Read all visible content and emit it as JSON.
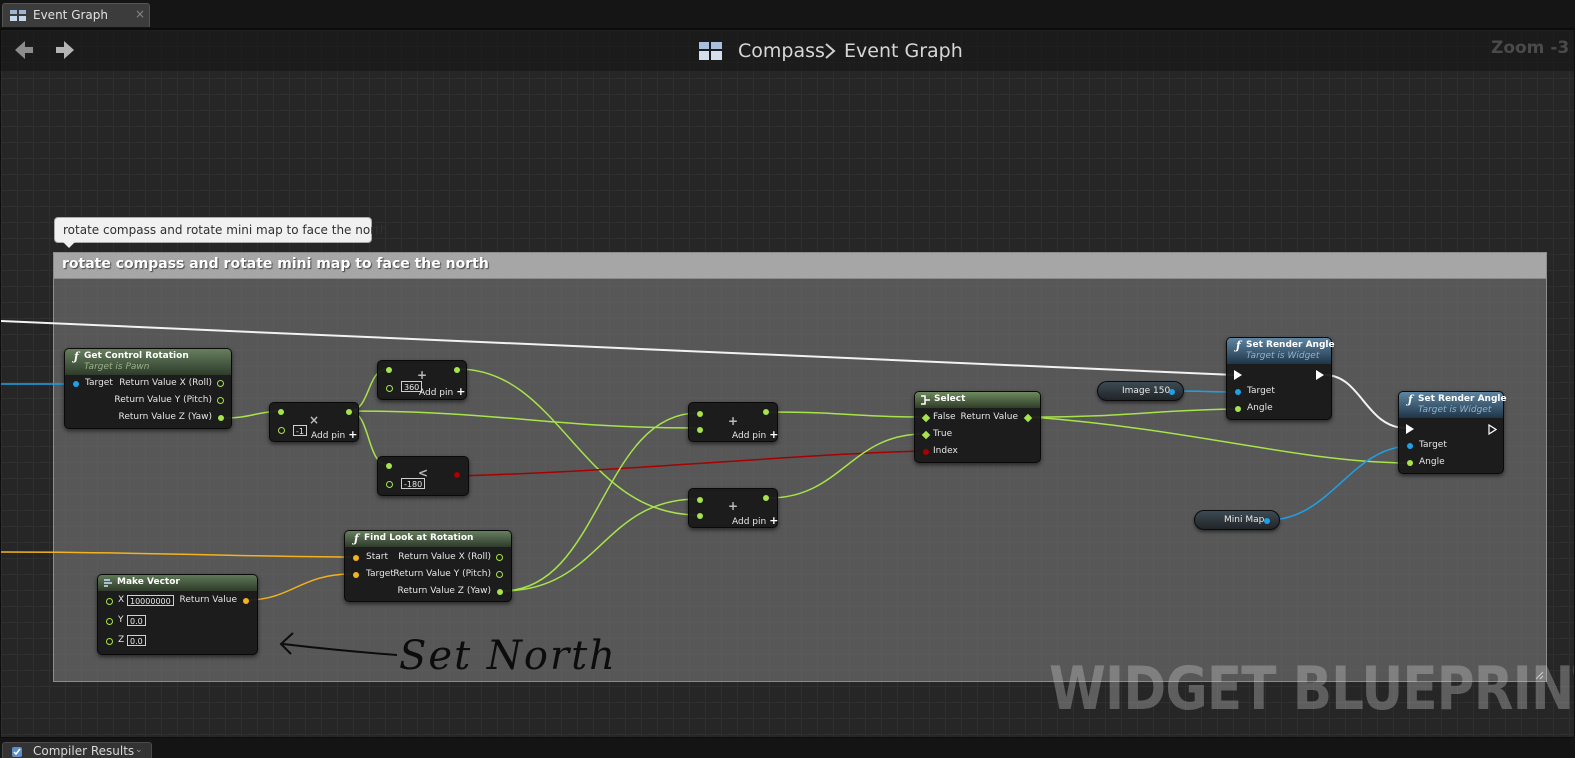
{
  "tab": {
    "label": "Event Graph",
    "close": "×"
  },
  "breadcrumb": {
    "blueprint": "Compass",
    "graph": "Event Graph"
  },
  "zoom": "Zoom -3",
  "comment": {
    "bubble": "rotate compass and rotate mini map to face the north",
    "title": "rotate compass and rotate mini map to face the north"
  },
  "nodes": {
    "get_control_rotation": {
      "title": "Get Control Rotation",
      "subtitle": "Target is Pawn",
      "in_target": "Target",
      "out_roll": "Return Value X (Roll)",
      "out_pitch": "Return Value Y (Pitch)",
      "out_yaw": "Return Value Z (Yaw)"
    },
    "multiply": {
      "operator": "×",
      "value": "-1",
      "add_pin": "Add pin"
    },
    "add_360": {
      "operator": "+",
      "value": "360",
      "add_pin": "Add pin"
    },
    "less_than": {
      "operator": "<",
      "value": "-180"
    },
    "add_a": {
      "operator": "+",
      "add_pin": "Add pin"
    },
    "add_b": {
      "operator": "+",
      "add_pin": "Add pin"
    },
    "select": {
      "title": "Select",
      "in_false": "False",
      "in_true": "True",
      "in_index": "Index",
      "out_value": "Return Value"
    },
    "image_var": {
      "name": "Image 150"
    },
    "minimap_var": {
      "name": "Mini Map"
    },
    "set_render_angle_1": {
      "title": "Set Render Angle",
      "subtitle": "Target is Widget",
      "in_target": "Target",
      "in_angle": "Angle"
    },
    "set_render_angle_2": {
      "title": "Set Render Angle",
      "subtitle": "Target is Widget",
      "in_target": "Target",
      "in_angle": "Angle"
    },
    "find_look_at": {
      "title": "Find Look at Rotation",
      "in_start": "Start",
      "in_target": "Target",
      "out_roll": "Return Value X (Roll)",
      "out_pitch": "Return Value Y (Pitch)",
      "out_yaw": "Return Value Z (Yaw)"
    },
    "make_vector": {
      "title": "Make Vector",
      "x_label": "X",
      "x_value": "10000000",
      "y_label": "Y",
      "y_value": "0.0",
      "z_label": "Z",
      "z_value": "0.0",
      "out_value": "Return Value"
    }
  },
  "annotation": "Set North",
  "watermark": "WIDGET BLUEPRINT",
  "bottom_tab": "Compiler Results",
  "colors": {
    "float_pin": "#a7e34a",
    "object_pin": "#1ea0e6",
    "vector_pin": "#f4b31d",
    "bool_pin": "#a70000",
    "exec_wire": "#ffffff"
  },
  "icons": [
    "event-graph-icon",
    "back-arrow-icon",
    "forward-arrow-icon",
    "blueprint-icon",
    "chevron-right-icon",
    "function-icon",
    "select-icon",
    "make-vector-icon",
    "compiler-results-icon"
  ]
}
